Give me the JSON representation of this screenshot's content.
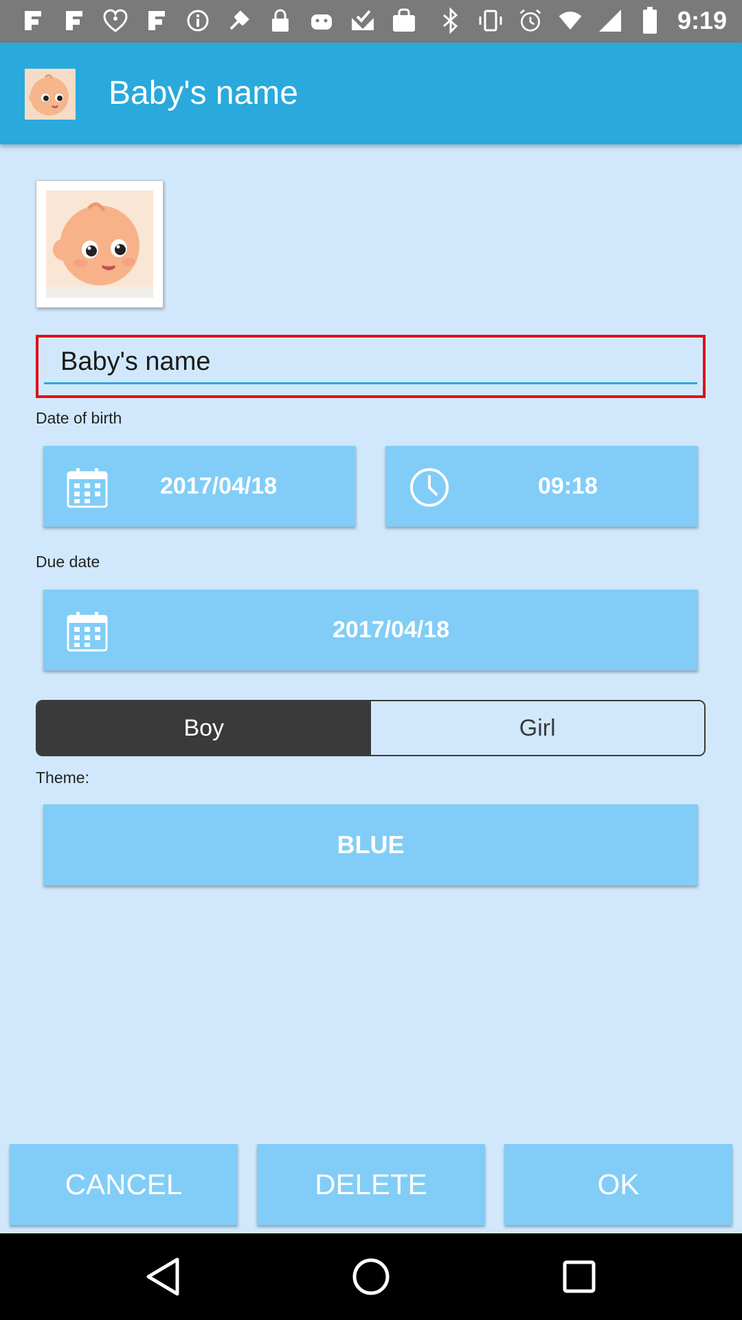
{
  "status_bar": {
    "time": "9:19",
    "left_icons": [
      "app-notification-icon",
      "app-notification-icon",
      "iheart-radio-icon",
      "app-notification-icon",
      "info-icon",
      "fake-gps-icon",
      "lock-icon",
      "android-icon",
      "task-done-icon",
      "shopping-bag-icon"
    ],
    "right_icons": [
      "bluetooth-icon",
      "vibrate-icon",
      "alarm-icon",
      "wifi-icon",
      "signal-icon",
      "battery-icon"
    ]
  },
  "app_bar": {
    "title": "Baby's name",
    "logo_icon": "baby-face-icon"
  },
  "form": {
    "name_value": "Baby's name",
    "date_of_birth_label": "Date of birth",
    "birth_date": "2017/04/18",
    "birth_time": "09:18",
    "due_date_label": "Due date",
    "due_date": "2017/04/18",
    "gender": {
      "boy_label": "Boy",
      "girl_label": "Girl",
      "selected": "Boy"
    },
    "theme_label": "Theme:",
    "theme_value": "BLUE"
  },
  "actions": {
    "cancel_label": "CANCEL",
    "delete_label": "DELETE",
    "ok_label": "OK"
  },
  "colors": {
    "app_bar": "#2aa9dc",
    "background": "#d1e8fc",
    "button": "#81cdf7",
    "error_border": "#e0101a",
    "toggle_selected": "#3a3a3a"
  }
}
